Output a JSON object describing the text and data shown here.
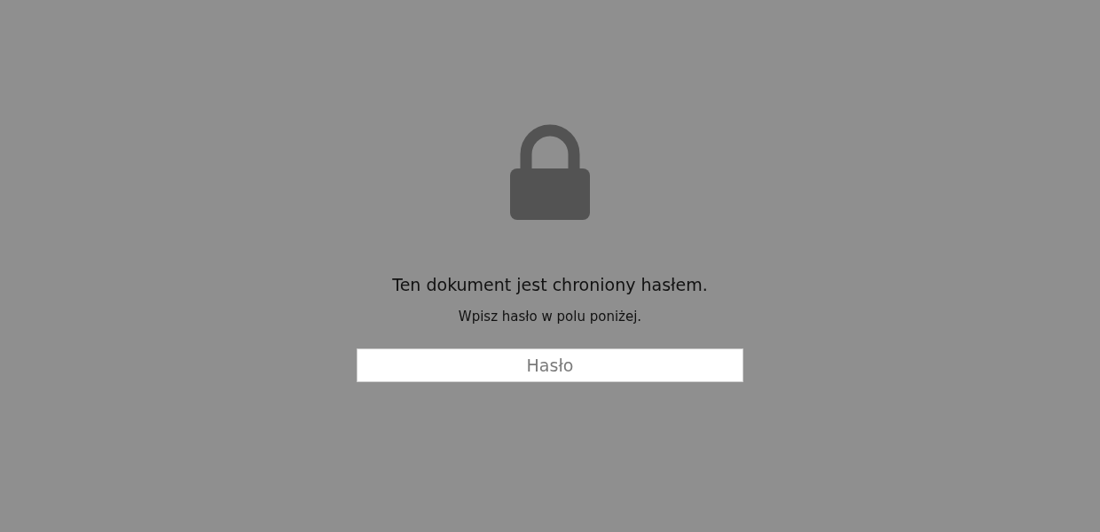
{
  "title": "Ten dokument jest chroniony hasłem.",
  "subtitle": "Wpisz hasło w polu poniżej.",
  "password_field": {
    "placeholder": "Hasło"
  }
}
